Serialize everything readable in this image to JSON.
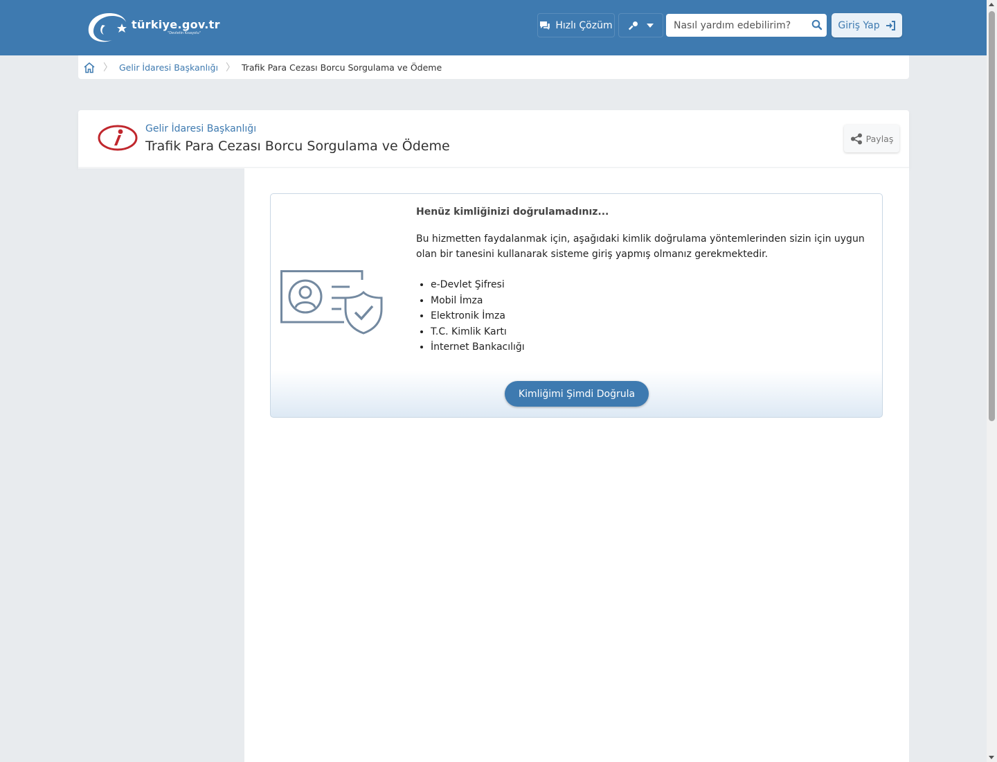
{
  "header": {
    "logo_text": "türkiye.gov.tr",
    "logo_tagline": "\"Devletin Kısayolu\"",
    "quick_solution_label": "Hızlı Çözüm",
    "search_placeholder": "Nasıl yardım edebilirim?",
    "login_label": "Giriş Yap"
  },
  "breadcrumb": {
    "items": [
      "Gelir İdaresi Başkanlığı",
      "Trafik Para Cezası Borcu Sorgulama ve Ödeme"
    ]
  },
  "page": {
    "institution": "Gelir İdaresi Başkanlığı",
    "title": "Trafik Para Cezası Borcu Sorgulama ve Ödeme",
    "share_label": "Paylaş"
  },
  "auth": {
    "title": "Henüz kimliğinizi doğrulamadınız...",
    "description": "Bu hizmetten faydalanmak için, aşağıdaki kimlik doğrulama yöntemlerinden sizin için uygun olan bir tanesini kullanarak sisteme giriş yapmış olmanız gerekmektedir.",
    "methods": [
      "e-Devlet Şifresi",
      "Mobil İmza",
      "Elektronik İmza",
      "T.C. Kimlik Kartı",
      "İnternet Bankacılığı"
    ],
    "verify_button": "Kimliğimi Şimdi Doğrula"
  },
  "icons": {
    "logo": "crescent-star-logo",
    "quick_solution": "chat-bubbles-icon",
    "tools": "key-icon",
    "search": "search-icon",
    "login": "sign-in-icon",
    "home": "home-icon",
    "share": "share-icon",
    "institution": "gib-logo",
    "illustration": "id-card-shield-icon"
  },
  "colors": {
    "header_bg": "#3e7ab0",
    "accent": "#3e7ab0",
    "page_bg": "#e8ebee",
    "institution_red": "#c0272d"
  }
}
